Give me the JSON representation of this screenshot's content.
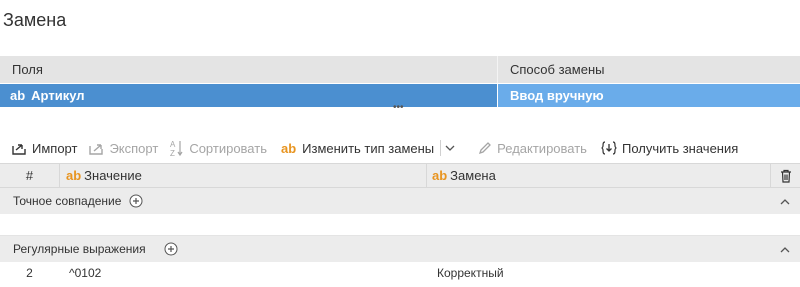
{
  "page": {
    "title": "Замена"
  },
  "fields_table": {
    "columns": [
      "Поля",
      "Способ замены"
    ],
    "row": {
      "type_tag": "ab",
      "field": "Артикул",
      "method": "Ввод вручную"
    }
  },
  "splitter": "•••",
  "toolbar": {
    "import": "Импорт",
    "export": "Экспорт",
    "sort": "Сортировать",
    "change_type_tag": "ab",
    "change_type": "Изменить тип замены",
    "edit": "Редактировать",
    "get_values": "Получить значения"
  },
  "grid": {
    "col_num": "#",
    "col_value_tag": "ab",
    "col_value": "Значение",
    "col_replace_tag": "ab",
    "col_replace": "Замена",
    "groups": [
      {
        "label": "Точное совпадение"
      },
      {
        "label": "Регулярные выражения"
      }
    ],
    "rows": [
      {
        "num": "2",
        "value": "^0102",
        "replace": "Корректный"
      }
    ]
  },
  "colors": {
    "selected_row": "#4b8fd0",
    "selected_row_light": "#6aacea",
    "ab_tag": "#e8941f"
  }
}
